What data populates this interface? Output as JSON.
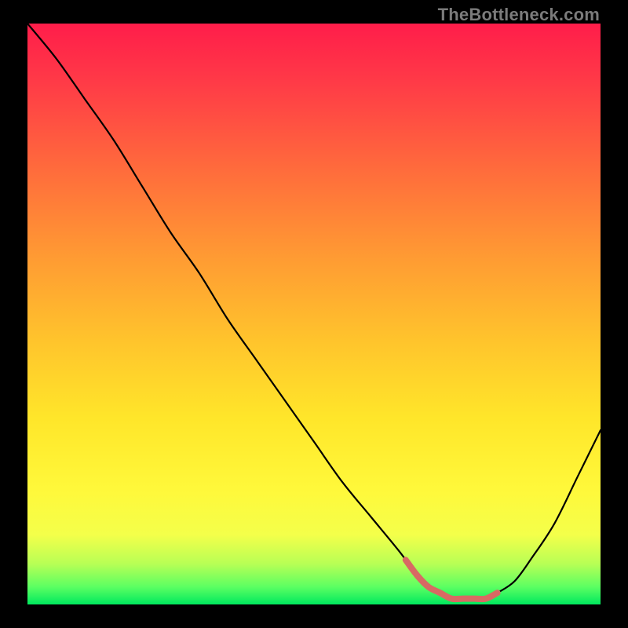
{
  "watermark": "TheBottleneck.com",
  "chart_data": {
    "type": "line",
    "title": "",
    "xlabel": "",
    "ylabel": "",
    "xlim": [
      0,
      100
    ],
    "ylim": [
      0,
      100
    ],
    "x": [
      0,
      5,
      10,
      15,
      20,
      25,
      30,
      35,
      40,
      45,
      50,
      55,
      60,
      65,
      68,
      70,
      72,
      74,
      76,
      78,
      80,
      82,
      85,
      88,
      92,
      96,
      100
    ],
    "values": [
      100,
      94,
      87,
      80,
      72,
      64,
      57,
      49,
      42,
      35,
      28,
      21,
      15,
      9,
      5,
      3,
      2,
      1,
      1,
      1,
      1,
      2,
      4,
      8,
      14,
      22,
      30
    ],
    "highlight_range_x": [
      66,
      82
    ],
    "colors": {
      "curve": "#000000",
      "highlight": "#d86a63"
    }
  }
}
